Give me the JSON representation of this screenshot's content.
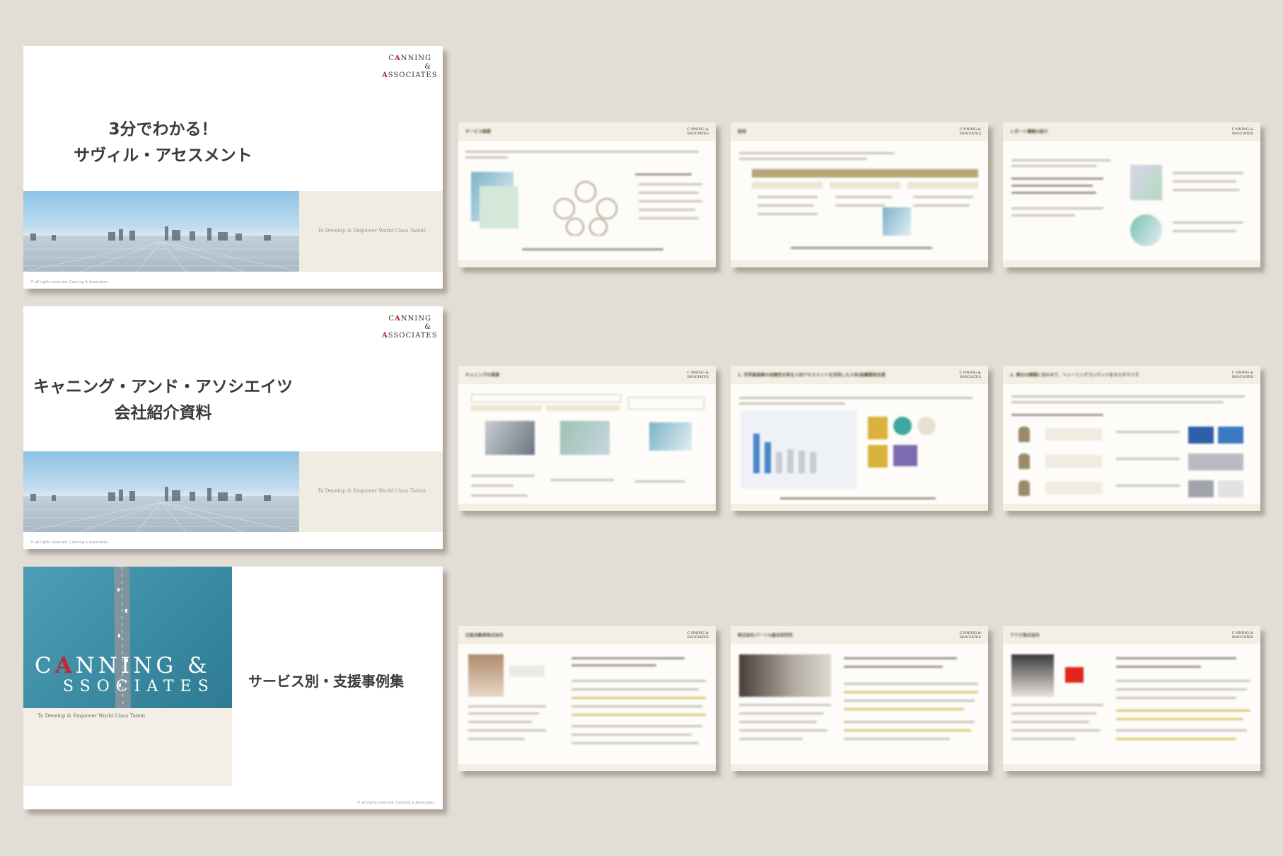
{
  "cover_slides": [
    {
      "logo_line1": "C",
      "logo_a": "A",
      "logo_rest1": "NNING &",
      "logo_rest2": "SSOCIATES",
      "title_line1": "3分でわかる！",
      "title_line2": "サヴィル・アセスメント",
      "tagline": "To Develop & Empower World Class Talent",
      "copyright": "© all rights reserved. Canning & Associates"
    },
    {
      "logo_line1": "C",
      "logo_a": "A",
      "logo_rest1": "NNING &",
      "logo_rest2": "SSOCIATES",
      "title_line1": "キャニング・アンド・アソシエイツ",
      "title_line2": "会社紹介資料",
      "tagline": "To Develop & Empower World Class Talent",
      "copyright": "© all rights reserved. Canning & Associates"
    },
    {
      "brand_c": "C",
      "brand_a": "A",
      "brand_rest1": "NNING &",
      "brand_rest2": "SSOCIATES",
      "tagline": "To Develop & Empower World Class Talent",
      "title": "サービス別・支援事例集",
      "copyright": "© all rights reserved. Canning & Associates"
    }
  ],
  "thumbnail_slides": [
    {
      "header": "サービス概要"
    },
    {
      "header": "採用"
    },
    {
      "header": "レポート種類の紹介"
    },
    {
      "header": "キャニングの事業"
    },
    {
      "header": "1. 世界最高峰の信頼性を誇る人材アセスメントを活用した人材/組織開発支援"
    },
    {
      "header": "2. 貴社の課題に合わせて、トレーニングコンテンツをカスタマイズ"
    },
    {
      "header": "日産自動車株式会社"
    },
    {
      "header": "株式会社パーソル総合研究所"
    },
    {
      "header": "アドビ株式会社"
    }
  ],
  "thumb_logo": {
    "a": "A",
    "line1": "C NNING &",
    "line2": "SSOCIATES"
  },
  "colors": {
    "background": "#e2ddd5",
    "teal": "#3a8ba3",
    "brand_red": "#b5252b",
    "beige": "#f0ece1"
  }
}
